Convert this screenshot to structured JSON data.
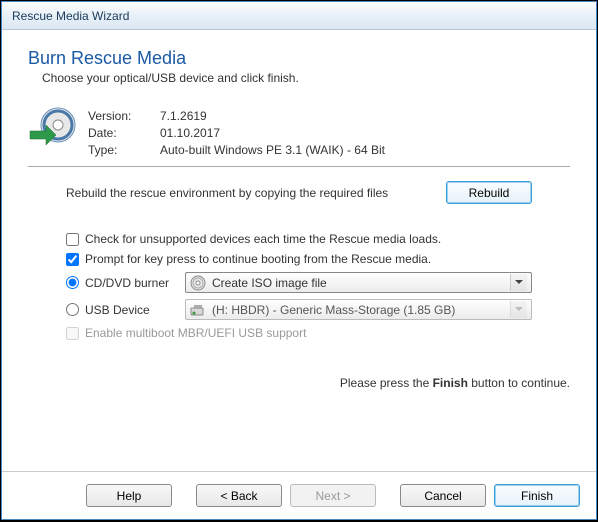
{
  "window": {
    "title": "Rescue Media Wizard"
  },
  "page": {
    "title": "Burn Rescue Media",
    "subtitle": "Choose your optical/USB device and click finish."
  },
  "info": {
    "version_label": "Version:",
    "version_value": "7.1.2619",
    "date_label": "Date:",
    "date_value": "01.10.2017",
    "type_label": "Type:",
    "type_value": "Auto-built Windows PE 3.1 (WAIK) - 64 Bit"
  },
  "rebuild": {
    "text": "Rebuild the rescue environment by copying the required files",
    "button": "Rebuild"
  },
  "options": {
    "check_unsupported": "Check for unsupported devices each time the Rescue media loads.",
    "prompt_keypress": "Prompt for key press to continue booting from the Rescue media.",
    "cd_label": "CD/DVD burner",
    "cd_selected": "Create ISO image file",
    "usb_label": "USB Device",
    "usb_selected": "(H: HBDR) - Generic Mass-Storage (1.85 GB)",
    "multiboot": "Enable multiboot MBR/UEFI USB support"
  },
  "instruction": {
    "pre": "Please press the ",
    "bold": "Finish",
    "post": " button to continue."
  },
  "footer": {
    "help": "Help",
    "back": "< Back",
    "next": "Next >",
    "cancel": "Cancel",
    "finish": "Finish"
  }
}
